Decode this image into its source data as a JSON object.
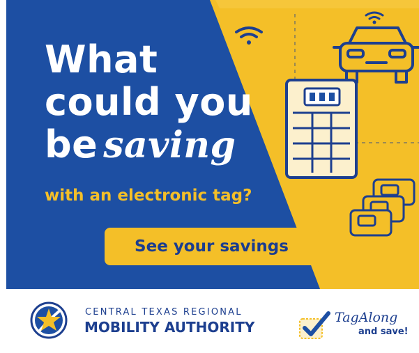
{
  "headline": {
    "line1": "What",
    "line2": "could you",
    "line3_prefix": "be",
    "line3_script": "saving"
  },
  "subheadline": "with an electronic tag?",
  "cta": {
    "label": "See your savings"
  },
  "organization": {
    "line1": "CENTRAL TEXAS REGIONAL",
    "line2": "MOBILITY AUTHORITY"
  },
  "program": {
    "name": "TagAlong",
    "tagline": "and save!"
  },
  "icons": [
    "wifi-icon",
    "car-icon",
    "calculator-icon",
    "toll-tag-icon",
    "star-logo-icon",
    "checkmark-icon"
  ],
  "colors": {
    "blue": "#1d4fa3",
    "yellow": "#f4bf28",
    "navy": "#1d3f8f",
    "cream": "#fcf0cd"
  }
}
